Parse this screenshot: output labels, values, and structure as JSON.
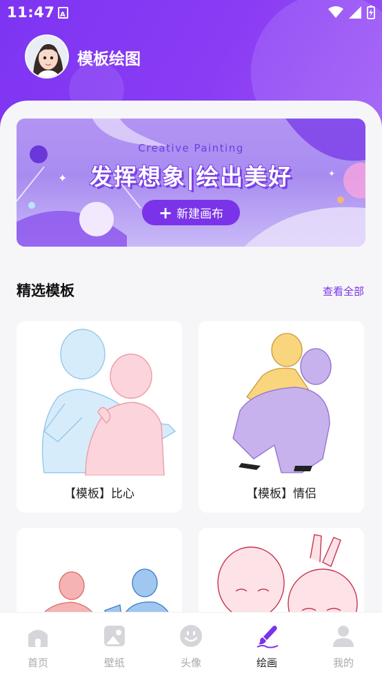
{
  "status_bar": {
    "time": "11:47"
  },
  "header": {
    "title": "模板绘图"
  },
  "banner": {
    "subtitle": "Creative Painting",
    "title": "发挥想象|绘出美好",
    "button_label": "新建画布"
  },
  "section": {
    "title": "精选模板",
    "view_all": "查看全部"
  },
  "templates": [
    {
      "caption": "【模板】比心"
    },
    {
      "caption": "【模板】情侣"
    },
    {
      "caption": ""
    },
    {
      "caption": ""
    }
  ],
  "bottom_nav": {
    "items": [
      {
        "label": "首页",
        "icon": "home-icon"
      },
      {
        "label": "壁纸",
        "icon": "wallpaper-icon"
      },
      {
        "label": "头像",
        "icon": "avatar-face-icon"
      },
      {
        "label": "绘画",
        "icon": "paint-brush-icon",
        "active": true
      },
      {
        "label": "我的",
        "icon": "profile-icon"
      }
    ]
  },
  "colors": {
    "accent": "#7a33e8",
    "header": "#8a3cf4",
    "inactive": "#a9a9ae"
  }
}
